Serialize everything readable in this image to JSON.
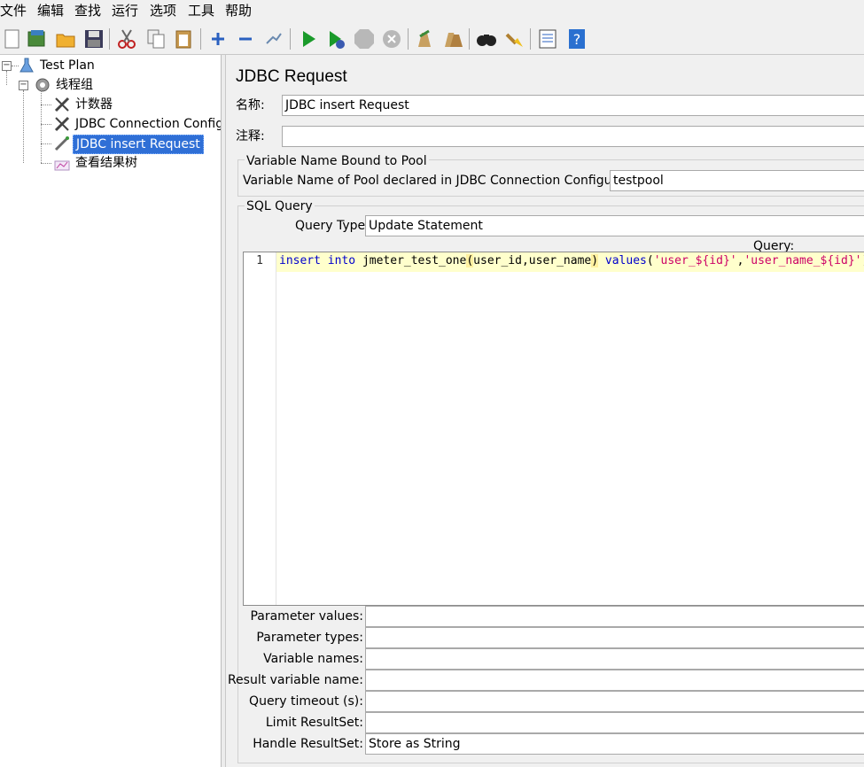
{
  "menu": [
    "文件",
    "编辑",
    "查找",
    "运行",
    "选项",
    "工具",
    "帮助"
  ],
  "toolbar": {
    "icons": [
      "new-icon",
      "templates-icon",
      "open-icon",
      "save-icon",
      "cut-icon",
      "copy-icon",
      "paste-icon",
      "expand-icon",
      "collapse-icon",
      "toggle-icon",
      "start-icon",
      "start-no-pause-icon",
      "stop-icon",
      "shutdown-icon",
      "clear-icon",
      "clear-all-icon",
      "search-icon",
      "reset-search-icon",
      "function-helper-icon",
      "help-icon"
    ]
  },
  "tree": {
    "root": "Test Plan",
    "thread_group": "线程组",
    "items": [
      {
        "label": "计数器",
        "icon": "counter-icon"
      },
      {
        "label": "JDBC Connection Configura",
        "icon": "config-icon"
      },
      {
        "label": "JDBC insert Request",
        "icon": "sampler-icon",
        "selected": true
      },
      {
        "label": "查看结果树",
        "icon": "listener-icon"
      }
    ]
  },
  "panel": {
    "title": "JDBC Request",
    "name_label": "名称:",
    "name_value": "JDBC insert Request",
    "comment_label": "注释:",
    "comment_value": "",
    "pool_group_title": "Variable Name Bound to Pool",
    "pool_label": "Variable Name of Pool declared in JDBC Connection Configuration:",
    "pool_value": "testpool",
    "sql_group_title": "SQL Query",
    "query_type_label": "Query Type:",
    "query_type_value": "Update Statement",
    "query_label": "Query:",
    "line_number": "1",
    "code": {
      "kw1": "insert",
      "kw2": "into",
      "ident": "jmeter_test_one",
      "paren_open": "(",
      "cols": "user_id,user_name",
      "paren_close": ")",
      "kw3": "values",
      "vals_open": "(",
      "str1": "'user_${id}'",
      "comma": ",",
      "str2": "'user_name_${id}'",
      "vals_close": ");"
    },
    "params": [
      {
        "label": "Parameter values:",
        "value": ""
      },
      {
        "label": "Parameter types:",
        "value": ""
      },
      {
        "label": "Variable names:",
        "value": ""
      },
      {
        "label": "Result variable name:",
        "value": ""
      },
      {
        "label": "Query timeout (s):",
        "value": ""
      },
      {
        "label": "Limit ResultSet:",
        "value": ""
      },
      {
        "label": "Handle ResultSet:",
        "value": "Store as String"
      }
    ]
  }
}
